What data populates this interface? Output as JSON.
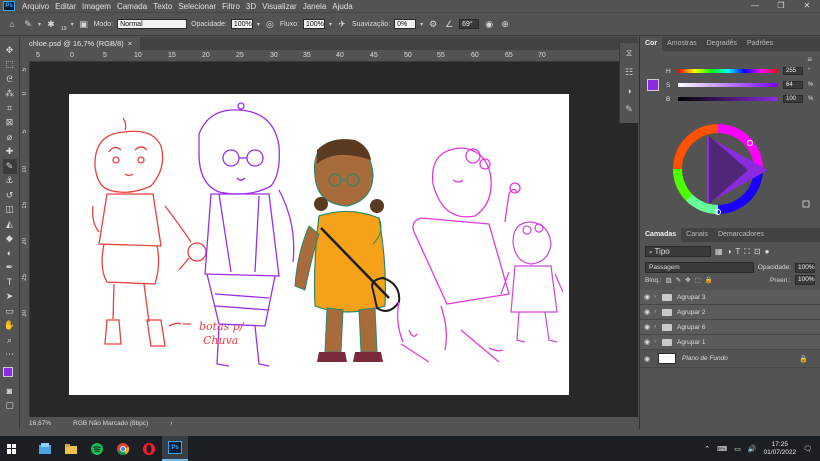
{
  "menubar": {
    "logo": "Ps",
    "items": [
      "Arquivo",
      "Editar",
      "Imagem",
      "Camada",
      "Texto",
      "Selecionar",
      "Filtro",
      "3D",
      "Visualizar",
      "Janela",
      "Ajuda"
    ],
    "window_controls": [
      "—",
      "❐",
      "✕"
    ]
  },
  "options": {
    "brush_size": "19",
    "mode_label": "Modo:",
    "mode_value": "Normal",
    "opacity_label": "Opacidade:",
    "opacity_value": "100%",
    "flow_label": "Fluxo:",
    "flow_value": "100%",
    "smoothing_label": "Suavização:",
    "smoothing_value": "0%",
    "angle_value": "69°"
  },
  "document": {
    "tab_label": "chloe.psd @ 16,7% (RGB/8)",
    "tab_close": "×",
    "ruler_h": [
      "5",
      "0",
      "5",
      "10",
      "15",
      "20",
      "25",
      "30",
      "35",
      "40",
      "45",
      "50",
      "55",
      "60",
      "65",
      "70"
    ],
    "ruler_v": [
      "5",
      "0",
      "5",
      "10",
      "15",
      "20",
      "25",
      "30"
    ],
    "annotation_line1": "botas p/",
    "annotation_line2": "Chuva"
  },
  "status": {
    "zoom": "16,67%",
    "profile": "RGB Não Marcado (8bpc)",
    "arrow": "›"
  },
  "color_panel": {
    "tabs": [
      "Cor",
      "Amostras",
      "Degradês",
      "Padrões"
    ],
    "h_label": "H",
    "s_label": "S",
    "b_label": "B",
    "h_value": "255",
    "s_value": "64",
    "b_value": "100",
    "h_unit": "°",
    "s_unit": "%",
    "b_unit": "%",
    "fg_color": "#8b2be0"
  },
  "layers_panel": {
    "tabs": [
      "Camadas",
      "Canais",
      "Demarcadores"
    ],
    "filter_label": "Tipo",
    "blend_mode": "Passagem",
    "opacity_label": "Opacidade:",
    "opacity_value": "100%",
    "lock_label": "Bloq.:",
    "fill_label": "Preen.:",
    "fill_value": "100%",
    "groups": [
      "Agrupar 3",
      "Agrupar 2",
      "Agrupar 6",
      "Agrupar 1"
    ],
    "background_layer": "Plano de Fundo"
  },
  "taskbar": {
    "apps": [
      "file-explorer",
      "folder",
      "spotify",
      "chrome",
      "opera",
      "photoshop"
    ],
    "ps_label": "Ps",
    "time": "17:25",
    "date": "01/07/2022"
  }
}
